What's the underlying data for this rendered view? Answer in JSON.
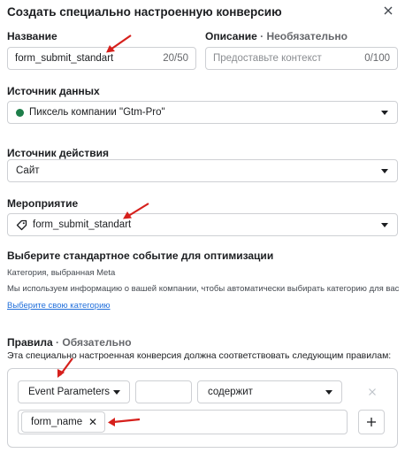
{
  "dialog": {
    "title": "Создать специально настроенную конверсию"
  },
  "name_field": {
    "label": "Название",
    "value": "form_submit_standart",
    "counter": "20/50"
  },
  "description_field": {
    "label": "Описание",
    "optional": "· Необязательно",
    "placeholder": "Предоставьте контекст",
    "counter": "0/100"
  },
  "data_source": {
    "label": "Источник данных",
    "value": "Пиксель компании \"Gtm-Pro\"",
    "status_color": "#1e7e4a"
  },
  "action_source": {
    "label": "Источник действия",
    "value": "Сайт"
  },
  "event": {
    "label": "Мероприятие",
    "value": "form_submit_standart"
  },
  "optimization": {
    "heading": "Выберите стандартное событие для оптимизации",
    "category_label": "Категория, выбранная Meta",
    "info": "Мы используем информацию о вашей компании, чтобы автоматически выбирать категорию для вас",
    "link": "Выберите свою категорию"
  },
  "rules": {
    "label": "Правила",
    "required": "· Обязательно",
    "description": "Эта специально настроенная конверсия должна соответствовать следующим правилам:",
    "parameter": "Event Parameters",
    "key_value": "",
    "operator": "содержит",
    "chip_value": "form_name"
  },
  "colors": {
    "annotation_arrow": "#d6201c",
    "link": "#216fdb"
  }
}
